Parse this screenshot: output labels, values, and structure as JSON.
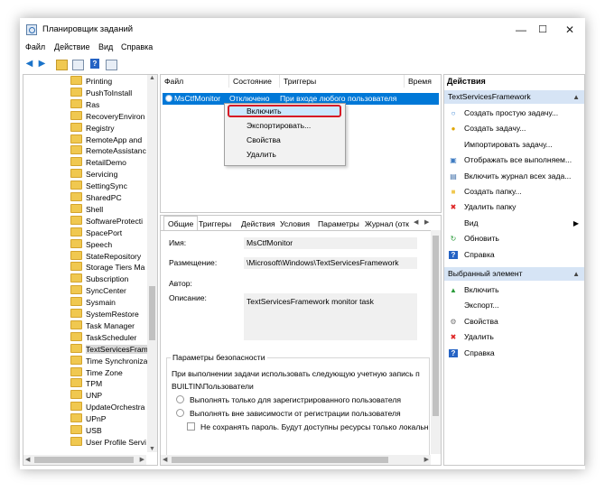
{
  "window": {
    "title": "Планировщик заданий",
    "min": "—",
    "max": "☐",
    "close": "✕"
  },
  "menu": [
    "Файл",
    "Действие",
    "Вид",
    "Справка"
  ],
  "tree": {
    "items": [
      "Printing",
      "PushToInstall",
      "Ras",
      "RecoveryEnviron",
      "Registry",
      "RemoteApp and",
      "RemoteAssistanc",
      "RetailDemo",
      "Servicing",
      "SettingSync",
      "SharedPC",
      "Shell",
      "SoftwareProtecti",
      "SpacePort",
      "Speech",
      "StateRepository",
      "Storage Tiers Ma",
      "Subscription",
      "SyncCenter",
      "Sysmain",
      "SystemRestore",
      "Task Manager",
      "TaskScheduler",
      "TextServicesFram",
      "Time Synchroniza",
      "Time Zone",
      "TPM",
      "UNP",
      "UpdateOrchestra",
      "UPnP",
      "USB",
      "User Profile Servi"
    ],
    "selected_index": 23
  },
  "tasks": {
    "columns": [
      "Файл",
      "Состояние",
      "Триггеры",
      "Время"
    ],
    "row": {
      "name": "MsCtfMonitor",
      "state": "Отключено",
      "trigger": "При входе любого пользователя"
    }
  },
  "context_menu": [
    "Включить",
    "Экспортировать...",
    "Свойства",
    "Удалить"
  ],
  "details": {
    "tabs": [
      "Общие",
      "Триггеры",
      "Действия",
      "Условия",
      "Параметры",
      "Журнал (отк"
    ],
    "name_label": "Имя:",
    "name_value": "MsCtfMonitor",
    "location_label": "Размещение:",
    "location_value": "\\Microsoft\\Windows\\TextServicesFramework",
    "author_label": "Автор:",
    "desc_label": "Описание:",
    "desc_value": "TextServicesFramework monitor task",
    "security_title": "Параметры безопасности",
    "security_run_as": "При выполнении задачи использовать следующую учетную запись п",
    "security_account": "BUILTIN\\Пользователи",
    "radio_logged_on": "Выполнять только для зарегистрированного пользователя",
    "radio_any": "Выполнять вне зависимости от регистрации пользователя",
    "check_no_store": "Не сохранять пароль. Будут доступны ресурсы только локальн"
  },
  "actions": {
    "header": "Действия",
    "section1": "TextServicesFramework",
    "items1": [
      {
        "label": "Создать простую задачу...",
        "icon": "create-basic-task-icon"
      },
      {
        "label": "Создать задачу...",
        "icon": "create-task-icon"
      },
      {
        "label": "Импортировать задачу...",
        "icon": ""
      },
      {
        "label": "Отображать все выполняем...",
        "icon": "running-tasks-icon"
      },
      {
        "label": "Включить журнал всех зада...",
        "icon": "history-icon"
      },
      {
        "label": "Создать папку...",
        "icon": "folder-icon"
      },
      {
        "label": "Удалить папку",
        "icon": "delete-icon"
      },
      {
        "label": "Вид",
        "icon": "",
        "submenu": true
      },
      {
        "label": "Обновить",
        "icon": "refresh-icon"
      },
      {
        "label": "Справка",
        "icon": "help-icon"
      }
    ],
    "section2": "Выбранный элемент",
    "items2": [
      {
        "label": "Включить",
        "icon": "enable-icon"
      },
      {
        "label": "Экспорт...",
        "icon": ""
      },
      {
        "label": "Свойства",
        "icon": "properties-icon"
      },
      {
        "label": "Удалить",
        "icon": "delete-icon"
      },
      {
        "label": "Справка",
        "icon": "help-icon"
      }
    ]
  },
  "colors": {
    "accent": "#0078d7",
    "context_highlight_border": "#d71b26",
    "section_header": "#d6e4f5"
  }
}
